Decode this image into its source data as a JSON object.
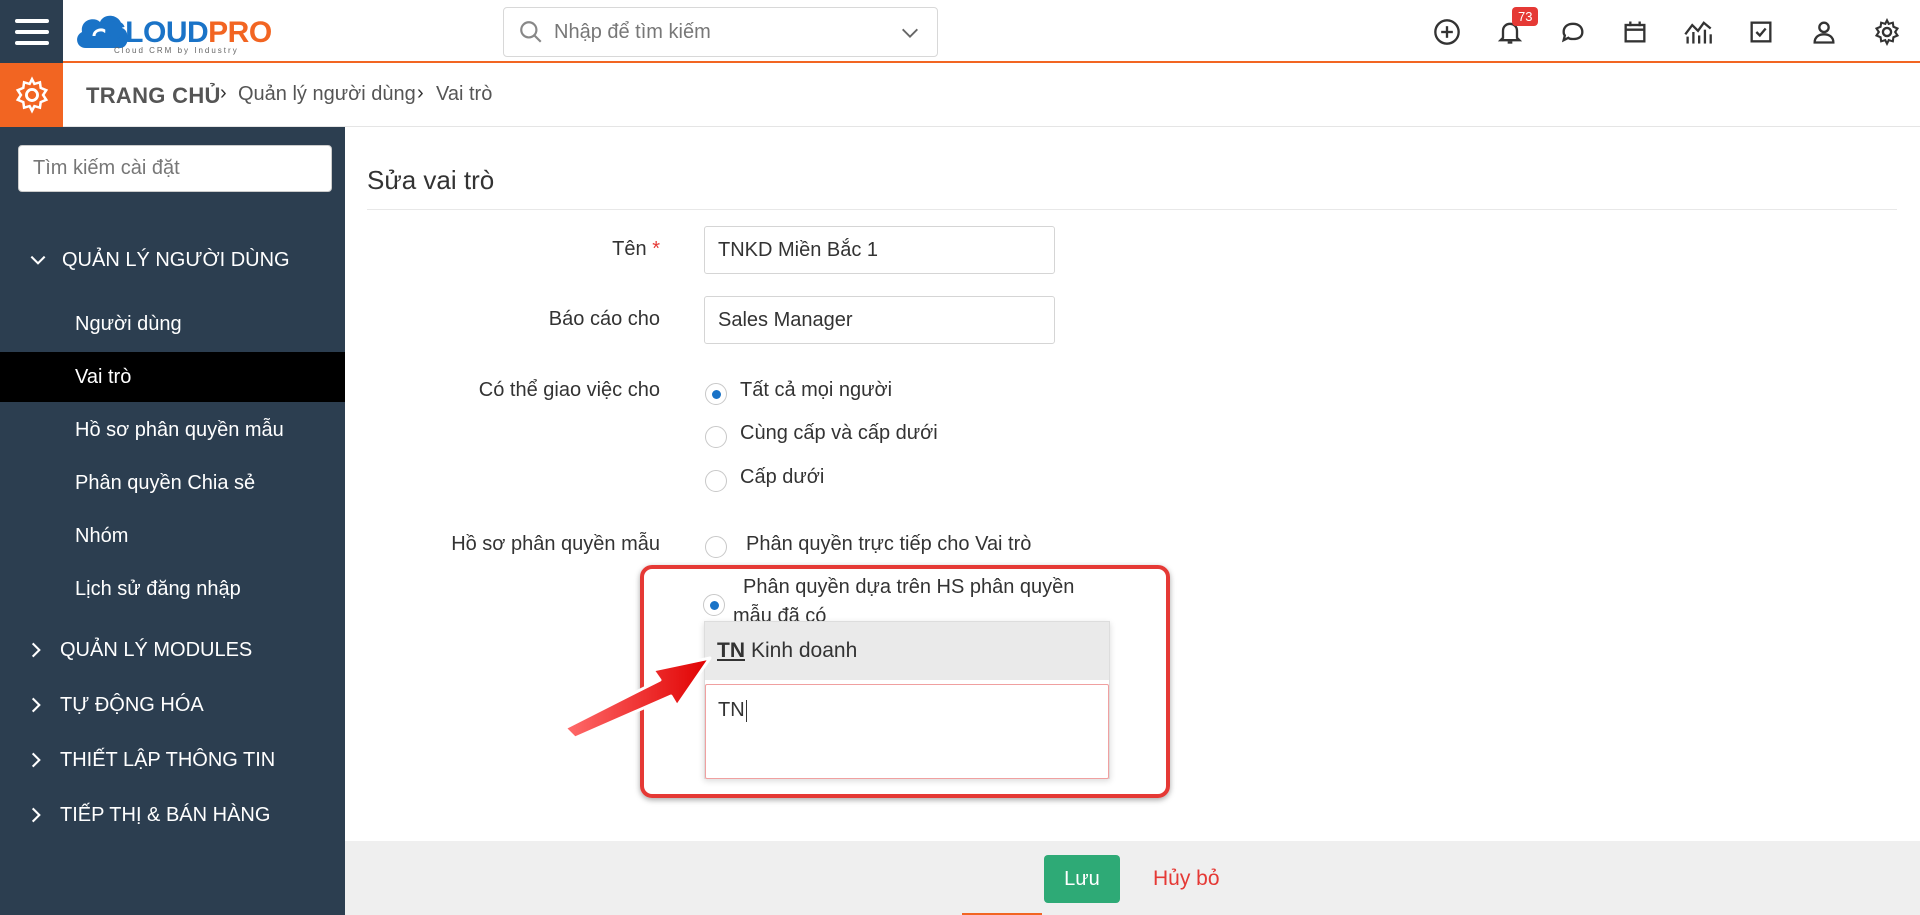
{
  "header": {
    "logo_text_a": "CLOUD",
    "logo_text_b": "PRO",
    "logo_tagline": "Cloud CRM by Industry",
    "search_placeholder": "Nhập để tìm kiếm",
    "notification_count": "73",
    "icons": [
      "add-icon",
      "bell-icon",
      "chat-icon",
      "calendar-icon",
      "analytics-icon",
      "task-icon",
      "user-icon",
      "settings-icon"
    ]
  },
  "breadcrumb": {
    "home": "TRANG CHỦ",
    "level1": "Quản lý người dùng",
    "level2": "Vai trò"
  },
  "sidebar": {
    "search_placeholder": "Tìm kiếm cài đặt",
    "section_user_mgmt": "QUẢN LÝ NGƯỜI DÙNG",
    "items": [
      {
        "label": "Người dùng",
        "active": false
      },
      {
        "label": "Vai trò",
        "active": true
      },
      {
        "label": "Hồ sơ phân quyền mẫu",
        "active": false
      },
      {
        "label": "Phân quyền Chia sẻ",
        "active": false
      },
      {
        "label": "Nhóm",
        "active": false
      },
      {
        "label": "Lịch sử đăng nhập",
        "active": false
      }
    ],
    "sections": [
      "QUẢN LÝ MODULES",
      "TỰ ĐỘNG HÓA",
      "THIẾT LẬP THÔNG TIN",
      "TIẾP THỊ & BÁN HÀNG"
    ]
  },
  "form": {
    "title": "Sửa vai trò",
    "name_label": "Tên",
    "name_required": "*",
    "name_value": "TNKD Miền Bắc 1",
    "report_to_label": "Báo cáo cho",
    "report_to_value": "Sales Manager",
    "assign_label": "Có thể giao việc cho",
    "assign_options": [
      {
        "label": "Tất cả mọi người",
        "checked": true
      },
      {
        "label": "Cùng cấp và cấp dưới",
        "checked": false
      },
      {
        "label": "Cấp dưới",
        "checked": false
      }
    ],
    "profile_label": "Hồ sơ phân quyền mẫu",
    "profile_options": [
      {
        "label": "Phân quyền trực tiếp cho Vai trò",
        "checked": false
      },
      {
        "label_line1": "Phân quyền dựa trên HS phân quyền",
        "label_line2": "mẫu đã có",
        "checked": true
      }
    ],
    "dropdown_option_match": "TN",
    "dropdown_option_rest": "Kinh doanh",
    "dropdown_input_value": "TN"
  },
  "footer": {
    "save_label": "Lưu",
    "cancel_label": "Hủy bỏ"
  },
  "colors": {
    "brand_orange": "#f26522",
    "sidebar_bg": "#2c3e50",
    "save_green": "#2eaa76",
    "cancel_red": "#e53935",
    "radio_blue": "#1a73c7"
  }
}
